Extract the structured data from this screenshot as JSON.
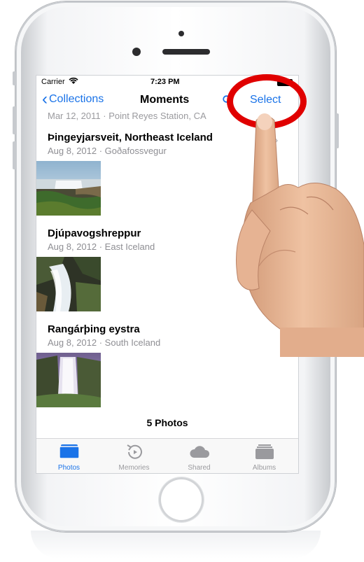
{
  "status_bar": {
    "carrier": "Carrier",
    "time": "7:23 PM",
    "wifi_icon": "wifi-icon",
    "battery_icon": "battery-icon"
  },
  "nav_bar": {
    "back_label": "Collections",
    "title": "Moments",
    "search_icon": "search-icon",
    "select_label": "Select"
  },
  "previous_header": "Mar 12, 2011  ·  Point Reyes Station, CA",
  "moments": [
    {
      "title": "Þingeyjarsveit, Northeast Iceland",
      "subtitle": "Aug 8, 2012  ·  Goðafossvegur"
    },
    {
      "title": "Djúpavogshreppur",
      "subtitle": "Aug 8, 2012  ·  East Iceland"
    },
    {
      "title": "Rangárþing eystra",
      "subtitle": "Aug 8, 2012  ·  South Iceland"
    }
  ],
  "photo_count": "5 Photos",
  "tabs": [
    {
      "label": "Photos",
      "icon": "photos-icon",
      "active": true
    },
    {
      "label": "Memories",
      "icon": "memories-icon",
      "active": false
    },
    {
      "label": "Shared",
      "icon": "cloud-icon",
      "active": false
    },
    {
      "label": "Albums",
      "icon": "albums-icon",
      "active": false
    }
  ],
  "colors": {
    "accent": "#1a73e8",
    "highlight_circle": "#e00000",
    "inactive_tab": "#9a9a9e"
  }
}
